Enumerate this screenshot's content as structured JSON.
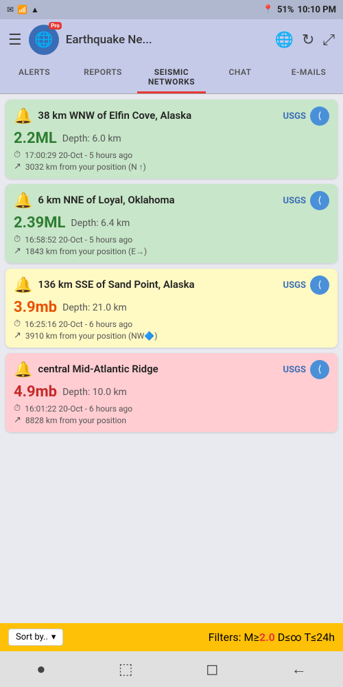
{
  "statusBar": {
    "left": [
      "✉",
      "☏",
      "↑"
    ],
    "battery": "51%",
    "time": "10:10 PM",
    "signal": "●●●●"
  },
  "header": {
    "title": "Earthquake Ne...",
    "globeIcon": "🌐",
    "proBadge": "Pro"
  },
  "tabs": [
    {
      "id": "alerts",
      "label": "ALERTS",
      "active": false
    },
    {
      "id": "reports",
      "label": "REPORTS",
      "active": false
    },
    {
      "id": "seismic",
      "label": "SEISMIC NETWORKS",
      "active": true
    },
    {
      "id": "chat",
      "label": "CHAT",
      "active": false
    },
    {
      "id": "emails",
      "label": "E-MAILS",
      "active": false
    }
  ],
  "earthquakes": [
    {
      "id": 1,
      "location": "38 km WNW of Elfin Cove, Alaska",
      "magnitude": "2.2ML",
      "depth": "Depth: 6.0 km",
      "time": "17:00:29 20-Oct - 5 hours ago",
      "distance": "3032 km from your position (N ↑)",
      "source": "USGS",
      "cardColor": "green",
      "magColor": "green",
      "icon": "🔔"
    },
    {
      "id": 2,
      "location": "6 km NNE of Loyal, Oklahoma",
      "magnitude": "2.39ML",
      "depth": "Depth: 6.4 km",
      "time": "16:58:52 20-Oct - 5 hours ago",
      "distance": "1843 km from your position (E→)",
      "source": "USGS",
      "cardColor": "green",
      "magColor": "green",
      "icon": "🔔"
    },
    {
      "id": 3,
      "location": "136 km SSE of Sand Point, Alaska",
      "magnitude": "3.9mb",
      "depth": "Depth: 21.0 km",
      "time": "16:25:16 20-Oct - 6 hours ago",
      "distance": "3910 km from your position (NW🔷)",
      "source": "USGS",
      "cardColor": "yellow",
      "magColor": "orange",
      "icon": "🔔"
    },
    {
      "id": 4,
      "location": "central Mid-Atlantic Ridge",
      "magnitude": "4.9mb",
      "depth": "Depth: 10.0 km",
      "time": "16:01:22 20-Oct - 6 hours ago",
      "distance": "8828 km from your position",
      "source": "USGS",
      "cardColor": "red",
      "magColor": "red",
      "icon": "🔔"
    }
  ],
  "footer": {
    "sortLabel": "Sort by..",
    "filterText": "Filters: M≥",
    "filterMag": "2.0",
    "filterRest": " D≤∞ T≤24h"
  },
  "nav": {
    "icons": [
      "●",
      "⬚",
      "◻",
      "←"
    ]
  }
}
